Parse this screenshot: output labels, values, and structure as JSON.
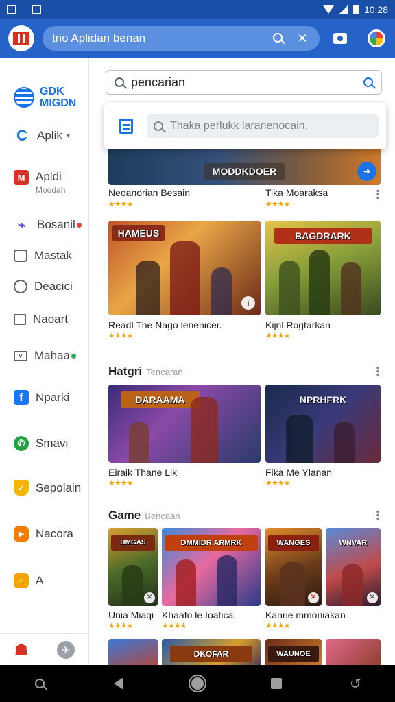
{
  "status_bar": {
    "time": "10:28"
  },
  "app_bar": {
    "search_text": "trio Aplidan benan"
  },
  "sidebar": {
    "brand": [
      "GDK",
      "MIGDN"
    ],
    "items": [
      {
        "label": "Aplik",
        "icon": "c-logo-icon",
        "color": "#1a73e8"
      },
      {
        "label": "Apldi",
        "sub": "Moodah",
        "icon": "m-icon",
        "color": "#d93025"
      },
      {
        "label": "Bosanil",
        "icon": "feather-icon",
        "color": "#5b4ee8",
        "dot": "#ea4335"
      },
      {
        "label": "Mastak",
        "icon": "calendar-icon",
        "color": "#5f6368"
      },
      {
        "label": "Deacici",
        "icon": "circle-icon",
        "color": "#5f6368"
      },
      {
        "label": "Naoart",
        "icon": "window-icon",
        "color": "#5f6368"
      },
      {
        "label": "Mahaa",
        "icon": "mail-icon",
        "color": "#5f6368",
        "dot": "#34a853"
      },
      {
        "label": "Nparki",
        "icon": "facebook-icon",
        "color": "#1877f2"
      },
      {
        "label": "Smavi",
        "icon": "whatsapp-icon",
        "color": "#25a244"
      },
      {
        "label": "Sepolain",
        "icon": "shield-icon",
        "color": "#f4b400"
      },
      {
        "label": "Nacora",
        "icon": "play-icon",
        "color": "#f57c00"
      },
      {
        "label": "A",
        "icon": "home-icon",
        "color": "#f4a300"
      }
    ]
  },
  "main": {
    "search_text": "pencarian",
    "popup_placeholder": "Thaka perlukk laranenocain.",
    "top_row": [
      {
        "banner": "MODDKDOER",
        "title": "Neoanorian Besain",
        "stars": "★★★★"
      },
      {
        "title": "Tika Moaraksa",
        "stars": "★★★★"
      }
    ],
    "row2": [
      {
        "banner": "HAMEUS",
        "title": "Readl The Nago lenenicer.",
        "stars": "★★★★"
      },
      {
        "banner": "BAGDRARK",
        "title": "Kijnl Rogtarkan",
        "stars": "★★★★"
      }
    ],
    "section1": {
      "title": "Hatgri",
      "sub": "Tencaran"
    },
    "row3": [
      {
        "banner": "DARAAMA",
        "title": "Eiraik Thane Lik",
        "stars": "★★★★"
      },
      {
        "banner": "NPRHFRK",
        "title": "Fika Me Ylanan",
        "stars": "★★★★"
      }
    ],
    "section2": {
      "title": "Game",
      "sub": "Bencaan"
    },
    "row4": [
      {
        "banner": "DMGAS",
        "title": "Unia Miaqi",
        "stars": "★★★★"
      },
      {
        "banner": "DMMIDR ARMRK",
        "title": "Khaafo le Ioatica.",
        "stars": "★★★★"
      },
      {
        "banner": "WANGES",
        "title": "Kanrie mmoniakan",
        "stars": "★★★★"
      },
      {
        "banner": "WNVAR",
        "title": "",
        "stars": ""
      }
    ],
    "row5": [
      {
        "banner": ""
      },
      {
        "banner": "DKOFAR"
      },
      {
        "banner": "WAUNOE"
      },
      {
        "banner": ""
      }
    ]
  }
}
